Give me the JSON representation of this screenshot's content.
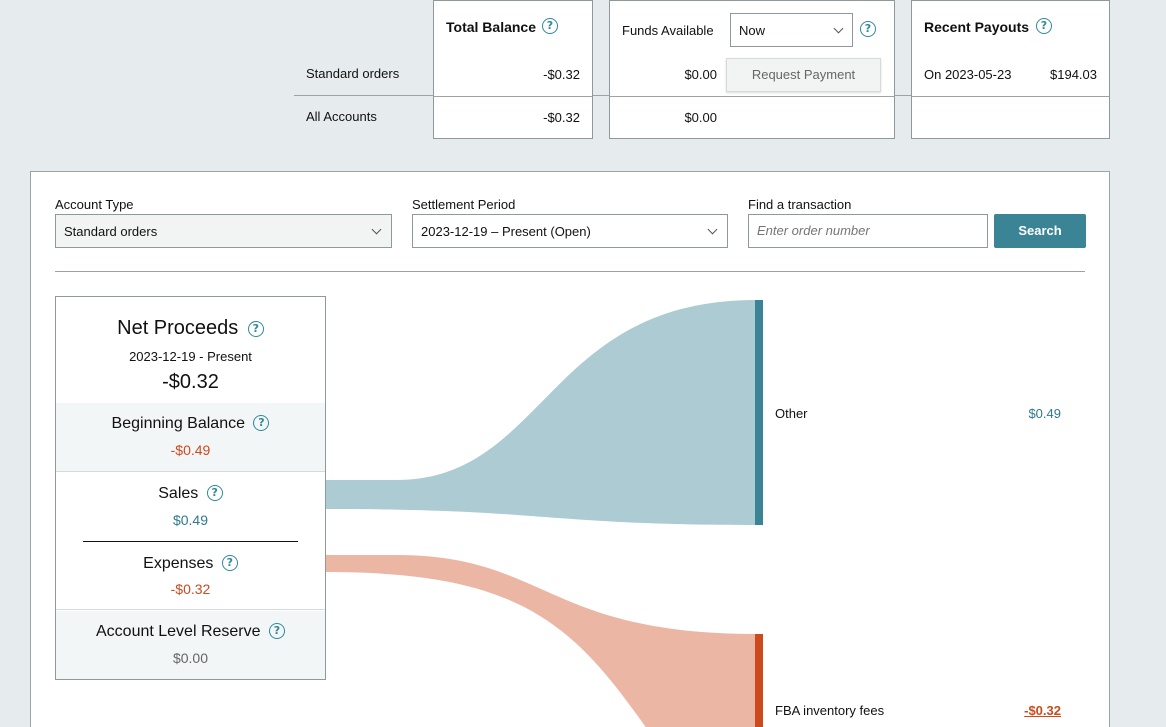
{
  "summary": {
    "rows": {
      "standard_orders": "Standard orders",
      "all_accounts": "All Accounts"
    },
    "total_balance": {
      "title": "Total Balance",
      "standard_orders": "-$0.32",
      "all_accounts": "-$0.32"
    },
    "funds_available": {
      "label": "Funds Available",
      "period_select": "Now",
      "standard_orders": "$0.00",
      "all_accounts": "$0.00",
      "request_button": "Request Payment"
    },
    "recent_payouts": {
      "title": "Recent Payouts",
      "date_text": "On 2023-05-23",
      "amount": "$194.03"
    }
  },
  "filters": {
    "account_type": {
      "label": "Account Type",
      "value": "Standard orders"
    },
    "settlement_period": {
      "label": "Settlement Period",
      "value": "2023-12-19 – Present (Open)"
    },
    "find": {
      "label": "Find a transaction",
      "placeholder": "Enter order number"
    },
    "search_button": "Search"
  },
  "net_proceeds": {
    "title": "Net Proceeds",
    "date_range": "2023-12-19 - Present",
    "total": "-$0.32",
    "beginning_balance": {
      "label": "Beginning Balance",
      "value": "-$0.49"
    },
    "sales": {
      "label": "Sales",
      "value": "$0.49"
    },
    "expenses": {
      "label": "Expenses",
      "value": "-$0.32"
    },
    "reserve": {
      "label": "Account Level Reserve",
      "value": "$0.00"
    }
  },
  "flow_legend": [
    {
      "label": "Other",
      "value": "$0.49"
    },
    {
      "label": "FBA inventory fees",
      "value": "-$0.32"
    }
  ],
  "colors": {
    "accent": "#3a8496",
    "negative": "#cc4a1e",
    "positive": "#2f7a8c",
    "sales_flow": "#adcbd3",
    "expense_flow": "#ecb6a5"
  },
  "icons": {
    "help": "question-circle-icon",
    "dropdown": "chevron-down-icon"
  }
}
